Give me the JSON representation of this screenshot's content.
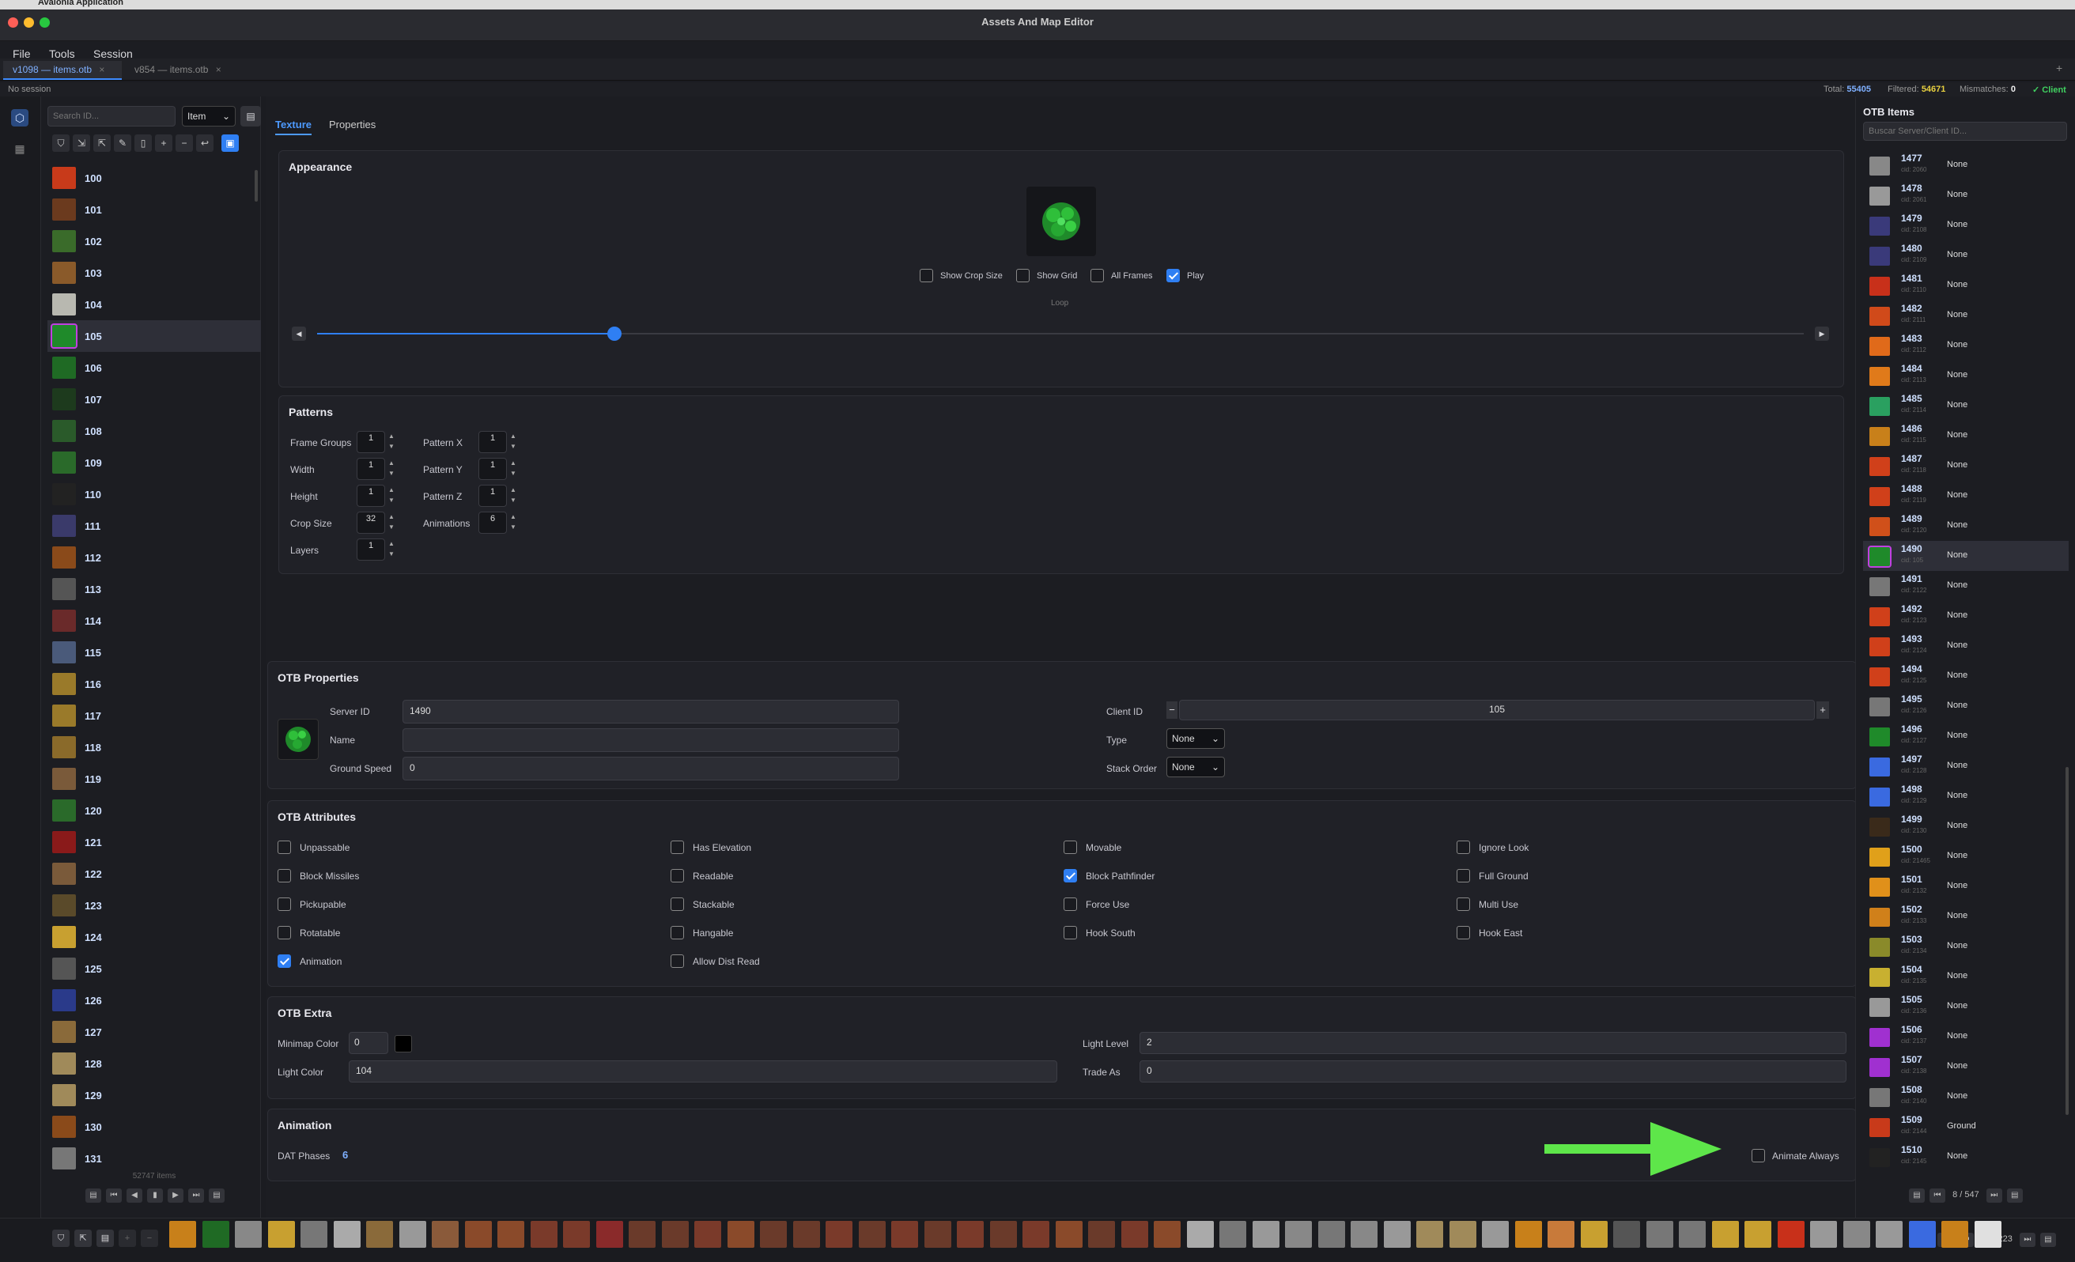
{
  "window": {
    "title": "Assets And Map Editor",
    "app_name": "Avalonia Application"
  },
  "menu": {
    "file": "File",
    "tools": "Tools",
    "session": "Session"
  },
  "doc_tabs": [
    {
      "label": "v1098 — items.otb",
      "active": true
    },
    {
      "label": "v854 — items.otb",
      "active": false
    }
  ],
  "status": {
    "session": "No session",
    "total_label": "Total:",
    "total": "55405",
    "filtered_label": "Filtered:",
    "filtered": "54671",
    "mismatches_label": "Mismatches:",
    "mismatches": "0",
    "client_label": "✓ Client"
  },
  "left": {
    "search_placeholder": "Search ID...",
    "type_select": "Item",
    "items": [
      {
        "id": "100",
        "color": "#c83a1a"
      },
      {
        "id": "101",
        "color": "#6b3a1e"
      },
      {
        "id": "102",
        "color": "#3a6b2a"
      },
      {
        "id": "103",
        "color": "#8a5a2a"
      },
      {
        "id": "104",
        "color": "#b8b8b0"
      },
      {
        "id": "105",
        "color": "#1f8a2a"
      },
      {
        "id": "106",
        "color": "#1f6a24"
      },
      {
        "id": "107",
        "color": "#1d3a1d"
      },
      {
        "id": "108",
        "color": "#2a5a2a"
      },
      {
        "id": "109",
        "color": "#2a6a2a"
      },
      {
        "id": "110",
        "color": "#222"
      },
      {
        "id": "111",
        "color": "#3a3a6a"
      },
      {
        "id": "112",
        "color": "#8a4a1a"
      },
      {
        "id": "113",
        "color": "#555"
      },
      {
        "id": "114",
        "color": "#6a2a2a"
      },
      {
        "id": "115",
        "color": "#4a5a7a"
      },
      {
        "id": "116",
        "color": "#9a7a2a"
      },
      {
        "id": "117",
        "color": "#9a7a2a"
      },
      {
        "id": "118",
        "color": "#8a6a2a"
      },
      {
        "id": "119",
        "color": "#7a5a3a"
      },
      {
        "id": "120",
        "color": "#2a6a2a"
      },
      {
        "id": "121",
        "color": "#8a1a1a"
      },
      {
        "id": "122",
        "color": "#7a5a3a"
      },
      {
        "id": "123",
        "color": "#5a4a2a"
      },
      {
        "id": "124",
        "color": "#c8a030"
      },
      {
        "id": "125",
        "color": "#555"
      },
      {
        "id": "126",
        "color": "#2a3a8a"
      },
      {
        "id": "127",
        "color": "#8a6a3a"
      },
      {
        "id": "128",
        "color": "#a08a5a"
      },
      {
        "id": "129",
        "color": "#a08a5a"
      },
      {
        "id": "130",
        "color": "#8a4a1a"
      },
      {
        "id": "131",
        "color": "#777"
      }
    ],
    "count_text": "52747 items"
  },
  "subtabs": {
    "texture": "Texture",
    "properties": "Properties"
  },
  "appearance": {
    "title": "Appearance",
    "show_crop": "Show Crop Size",
    "show_grid": "Show Grid",
    "all_frames": "All Frames",
    "play": "Play",
    "loop": "Loop",
    "slider_pos": 0.2
  },
  "patterns": {
    "title": "Patterns",
    "left": [
      {
        "label": "Frame Groups",
        "value": "1"
      },
      {
        "label": "Width",
        "value": "1"
      },
      {
        "label": "Height",
        "value": "1"
      },
      {
        "label": "Crop Size",
        "value": "32"
      },
      {
        "label": "Layers",
        "value": "1"
      }
    ],
    "right": [
      {
        "label": "Pattern X",
        "value": "1"
      },
      {
        "label": "Pattern Y",
        "value": "1"
      },
      {
        "label": "Pattern Z",
        "value": "1"
      },
      {
        "label": "Animations",
        "value": "6"
      }
    ]
  },
  "otb_properties": {
    "title": "OTB Properties",
    "server_id_label": "Server ID",
    "server_id": "1490",
    "name_label": "Name",
    "name": "",
    "ground_speed_label": "Ground Speed",
    "ground_speed": "0",
    "client_id_label": "Client ID",
    "client_id": "105",
    "type_label": "Type",
    "type": "None",
    "stack_order_label": "Stack Order",
    "stack_order": "None"
  },
  "otb_attributes": {
    "title": "OTB Attributes",
    "columns": [
      [
        {
          "label": "Unpassable",
          "checked": false
        },
        {
          "label": "Block Missiles",
          "checked": false
        },
        {
          "label": "Pickupable",
          "checked": false
        },
        {
          "label": "Rotatable",
          "checked": false
        },
        {
          "label": "Animation",
          "checked": true
        }
      ],
      [
        {
          "label": "Has Elevation",
          "checked": false
        },
        {
          "label": "Readable",
          "checked": false
        },
        {
          "label": "Stackable",
          "checked": false
        },
        {
          "label": "Hangable",
          "checked": false
        },
        {
          "label": "Allow Dist Read",
          "checked": false
        }
      ],
      [
        {
          "label": "Movable",
          "checked": false
        },
        {
          "label": "Block Pathfinder",
          "checked": true
        },
        {
          "label": "Force Use",
          "checked": false
        },
        {
          "label": "Hook South",
          "checked": false
        }
      ],
      [
        {
          "label": "Ignore Look",
          "checked": false
        },
        {
          "label": "Full Ground",
          "checked": false
        },
        {
          "label": "Multi Use",
          "checked": false
        },
        {
          "label": "Hook East",
          "checked": false
        }
      ]
    ]
  },
  "otb_extra": {
    "title": "OTB Extra",
    "minimap_label": "Minimap Color",
    "minimap": "0",
    "light_color_label": "Light Color",
    "light_color": "104",
    "light_level_label": "Light Level",
    "light_level": "2",
    "trade_as_label": "Trade As",
    "trade_as": "0"
  },
  "animation": {
    "title": "Animation",
    "dat_phases_label": "DAT Phases",
    "dat_phases": "6",
    "animate_always": "Animate Always"
  },
  "right": {
    "title": "OTB Items",
    "search_placeholder": "Buscar Server/Client ID...",
    "items": [
      {
        "id": "1477",
        "cid": "cid: 2060",
        "type": "None",
        "color": "#888"
      },
      {
        "id": "1478",
        "cid": "cid: 2061",
        "type": "None",
        "color": "#999"
      },
      {
        "id": "1479",
        "cid": "cid: 2108",
        "type": "None",
        "color": "#3a3a7a"
      },
      {
        "id": "1480",
        "cid": "cid: 2109",
        "type": "None",
        "color": "#3a3a7a"
      },
      {
        "id": "1481",
        "cid": "cid: 2110",
        "type": "None",
        "color": "#c8301a"
      },
      {
        "id": "1482",
        "cid": "cid: 2111",
        "type": "None",
        "color": "#d04a1a"
      },
      {
        "id": "1483",
        "cid": "cid: 2112",
        "type": "None",
        "color": "#e06a1a"
      },
      {
        "id": "1484",
        "cid": "cid: 2113",
        "type": "None",
        "color": "#e07a1a"
      },
      {
        "id": "1485",
        "cid": "cid: 2114",
        "type": "None",
        "color": "#2aa060"
      },
      {
        "id": "1486",
        "cid": "cid: 2115",
        "type": "None",
        "color": "#c8801a"
      },
      {
        "id": "1487",
        "cid": "cid: 2118",
        "type": "None",
        "color": "#d0401a"
      },
      {
        "id": "1488",
        "cid": "cid: 2119",
        "type": "None",
        "color": "#d0401a"
      },
      {
        "id": "1489",
        "cid": "cid: 2120",
        "type": "None",
        "color": "#d0501a"
      },
      {
        "id": "1490",
        "cid": "cid: 105",
        "type": "None",
        "color": "#1f8a2a"
      },
      {
        "id": "1491",
        "cid": "cid: 2122",
        "type": "None",
        "color": "#777"
      },
      {
        "id": "1492",
        "cid": "cid: 2123",
        "type": "None",
        "color": "#d0401a"
      },
      {
        "id": "1493",
        "cid": "cid: 2124",
        "type": "None",
        "color": "#d0401a"
      },
      {
        "id": "1494",
        "cid": "cid: 2125",
        "type": "None",
        "color": "#d0401a"
      },
      {
        "id": "1495",
        "cid": "cid: 2126",
        "type": "None",
        "color": "#777"
      },
      {
        "id": "1496",
        "cid": "cid: 2127",
        "type": "None",
        "color": "#1f8a2a"
      },
      {
        "id": "1497",
        "cid": "cid: 2128",
        "type": "None",
        "color": "#3a6ae0"
      },
      {
        "id": "1498",
        "cid": "cid: 2129",
        "type": "None",
        "color": "#3a6ae0"
      },
      {
        "id": "1499",
        "cid": "cid: 2130",
        "type": "None",
        "color": "#3a2a1a"
      },
      {
        "id": "1500",
        "cid": "cid: 21465",
        "type": "None",
        "color": "#e0a01a"
      },
      {
        "id": "1501",
        "cid": "cid: 2132",
        "type": "None",
        "color": "#e0901a"
      },
      {
        "id": "1502",
        "cid": "cid: 2133",
        "type": "None",
        "color": "#d0801a"
      },
      {
        "id": "1503",
        "cid": "cid: 2134",
        "type": "None",
        "color": "#8a8a2a"
      },
      {
        "id": "1504",
        "cid": "cid: 2135",
        "type": "None",
        "color": "#c8b030"
      },
      {
        "id": "1505",
        "cid": "cid: 2136",
        "type": "None",
        "color": "#999"
      },
      {
        "id": "1506",
        "cid": "cid: 2137",
        "type": "None",
        "color": "#a030d0"
      },
      {
        "id": "1507",
        "cid": "cid: 2138",
        "type": "None",
        "color": "#a030d0"
      },
      {
        "id": "1508",
        "cid": "cid: 2140",
        "type": "None",
        "color": "#777"
      },
      {
        "id": "1509",
        "cid": "cid: 2144",
        "type": "Ground",
        "color": "#c83a1a"
      },
      {
        "id": "1510",
        "cid": "cid: 2145",
        "type": "None",
        "color": "#222"
      }
    ],
    "page_text": "8 / 547"
  },
  "bottom": {
    "page_text": "1 / 6223",
    "thumbs": [
      "#c8801a",
      "#1f6a24",
      "#888",
      "#c8a030",
      "#777",
      "#aaa",
      "#8a6a3a",
      "#999",
      "#8a5a3a",
      "#8a4a2a",
      "#8a4a2a",
      "#7a3a2a",
      "#7a3a2a",
      "#8a2a2a",
      "#6a3a2a",
      "#6a3a2a",
      "#7a3a2a",
      "#8a4a2a",
      "#6a3a2a",
      "#6a3a2a",
      "#7a3a2a",
      "#6a3a2a",
      "#7a3a2a",
      "#6a3a2a",
      "#7a3a2a",
      "#6a3a2a",
      "#7a3a2a",
      "#8a4a2a",
      "#6a3a2a",
      "#7a3a2a",
      "#8a4a2a",
      "#aaa",
      "#777",
      "#999",
      "#888",
      "#777",
      "#888",
      "#999",
      "#a08a5a",
      "#a08a5a",
      "#999",
      "#c8801a",
      "#c87a3a",
      "#c8a030",
      "#555",
      "#777",
      "#777",
      "#c8a030",
      "#c8a030",
      "#c8301a",
      "#999",
      "#888",
      "#999",
      "#3a6ae0",
      "#c8801a",
      "#e0e0e0"
    ]
  }
}
